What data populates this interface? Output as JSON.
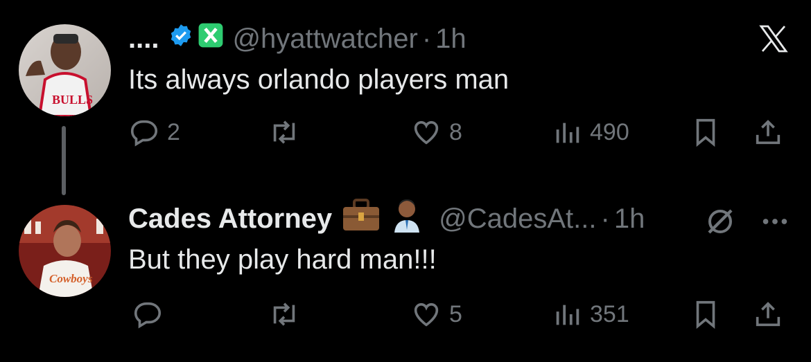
{
  "brand": {
    "logo": "x-logo-icon",
    "color": "#e7e9ea"
  },
  "colors": {
    "background": "#000000",
    "text": "#e7e9ea",
    "muted": "#71767b",
    "verified": "#1d9bf0",
    "green_badge": "#2ecc71"
  },
  "tweets": [
    {
      "display_name": "....",
      "handle": "@hyattwatcher",
      "separator": "·",
      "time": "1h",
      "text": "Its always orlando players man",
      "badges": [
        "verified-badge-icon",
        "green-x-badge-icon"
      ],
      "avatar_jersey_text": "BULLS",
      "counts": {
        "replies": "2",
        "reposts": "",
        "likes": "8",
        "views": "490"
      }
    },
    {
      "display_name": "Cades Attorney",
      "handle": "@CadesAt...",
      "separator": "·",
      "time": "1h",
      "text": "But they play hard man!!!",
      "emojis": [
        "briefcase-emoji",
        "man-office-worker-emoji"
      ],
      "avatar_jersey_text": "Cowboys",
      "counts": {
        "replies": "",
        "reposts": "",
        "likes": "5",
        "views": "351"
      }
    }
  ],
  "icons": {
    "reply": "reply-icon",
    "repost": "repost-icon",
    "like": "like-icon",
    "views": "views-icon",
    "bookmark": "bookmark-icon",
    "share": "share-icon",
    "grok": "grok-icon",
    "more": "more-icon"
  }
}
